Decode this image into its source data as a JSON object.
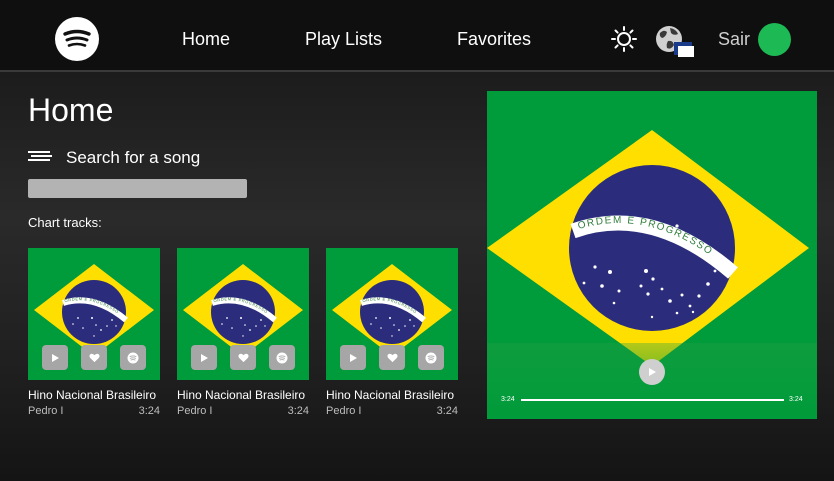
{
  "nav": {
    "logo": "spotify-logo",
    "links": [
      "Home",
      "Play Lists",
      "Favorites"
    ],
    "theme_icon": "sun-icon",
    "language_icon": "globe-flag-icon",
    "logout_label": "Sair",
    "avatar_color": "#1db954"
  },
  "main": {
    "title": "Home",
    "search_label": "Search for a song",
    "search_placeholder": "",
    "chart_label": "Chart tracks:"
  },
  "tracks": [
    {
      "title": "Hino Nacional Brasileiro",
      "artist": "Pedro I",
      "duration": "3:24",
      "flag_text": "ORDEM E PROGRESSO"
    },
    {
      "title": "Hino Nacional Brasileiro",
      "artist": "Pedro I",
      "duration": "3:24",
      "flag_text": "ORDEM E PROGRESSO"
    },
    {
      "title": "Hino Nacional Brasileiro",
      "artist": "Pedro I",
      "duration": "3:24",
      "flag_text": "ORDEM E PROGRESSO"
    }
  ],
  "card_actions": [
    "play-icon",
    "heart-icon",
    "spotify-icon"
  ],
  "player": {
    "flag_text": "ORDEM E PROGRESSO",
    "current_time": "3:24",
    "total_time": "3:24",
    "progress": 1.0
  },
  "colors": {
    "flag_green": "#009b3a",
    "flag_yellow": "#fedf00",
    "flag_blue": "#2b2c7c",
    "flag_band": "#ffffff",
    "flag_text": "#2f7d3b"
  }
}
